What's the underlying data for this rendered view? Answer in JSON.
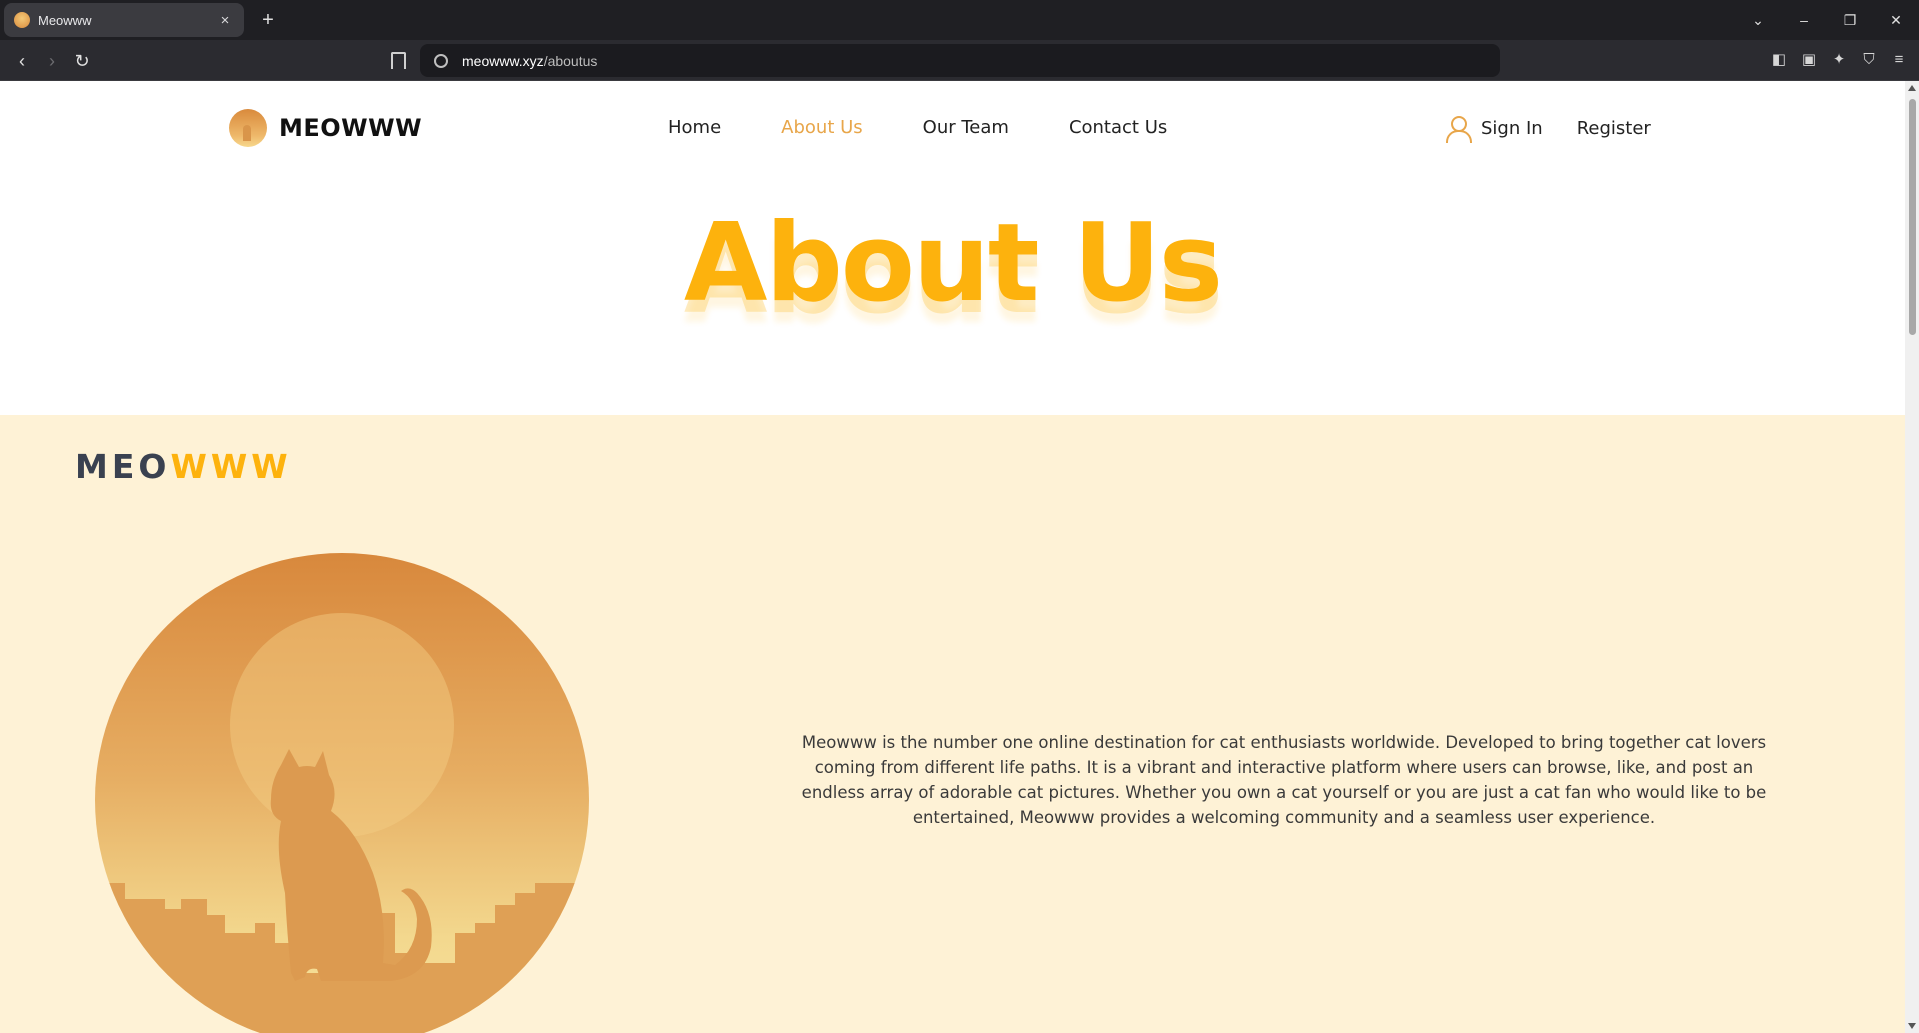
{
  "browser": {
    "tab_title": "Meowww",
    "tab_close": "×",
    "new_tab": "+",
    "url_host": "meowww.xyz",
    "url_path": "/aboutus"
  },
  "header": {
    "brand": "MEOWWW",
    "nav": [
      {
        "label": "Home",
        "active": false
      },
      {
        "label": "About Us",
        "active": true
      },
      {
        "label": "Our Team",
        "active": false
      },
      {
        "label": "Contact Us",
        "active": false
      }
    ],
    "sign_in": "Sign In",
    "register": "Register"
  },
  "hero": {
    "title": "About Us"
  },
  "about": {
    "brand_dark": "MEO",
    "brand_gold": "WWW",
    "description": "Meowww is the number one online destination for cat enthusiasts worldwide. Developed to bring together cat lovers coming from different life paths. It is a vibrant and interactive platform where users can browse, like, and post an endless array of adorable cat pictures. Whether you own a cat yourself or you are just a cat fan who would like to be entertained, Meowww provides a welcoming community and a seamless user experience."
  },
  "colors": {
    "accent": "#fdb20d",
    "nav_active": "#e8a64a",
    "section_bg": "#fef2d6",
    "brand_dark": "#3a4150"
  }
}
